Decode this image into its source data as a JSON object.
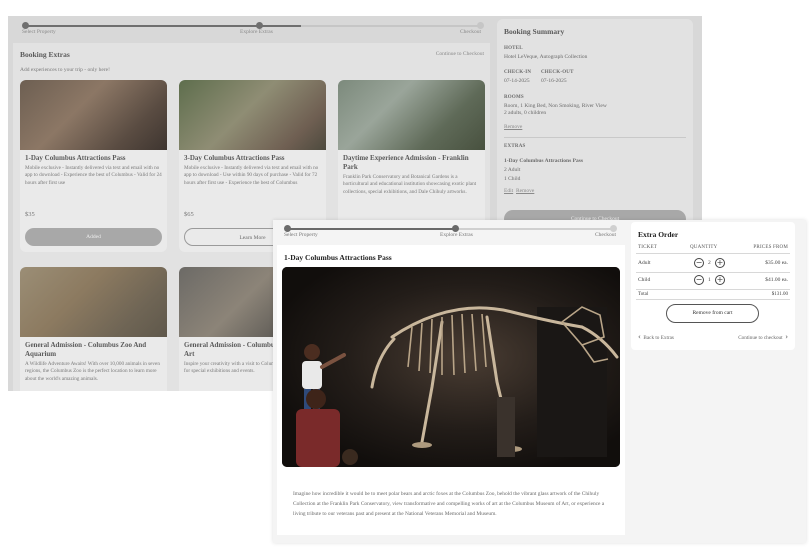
{
  "progress": {
    "steps": [
      "Select Property",
      "Explore Extras",
      "Checkout"
    ],
    "current_step": 2
  },
  "background": {
    "main_title": "Booking Extras",
    "continue_link": "Continue to Checkout",
    "subtitle": "Add experiences to your trip - only here!",
    "cards": [
      {
        "title": "1-Day Columbus Attractions Pass",
        "description": "Mobile exclusive - Instantly delivered via text and email with no app to download - Experience the best of Columbus - Valid for 24 hours after first use",
        "price": "$35",
        "button": "Added",
        "button_style": "filled"
      },
      {
        "title": "3-Day Columbus Attractions Pass",
        "description": "Mobile exclusive - Instantly delivered via text and email with no app to download - Use within 90 days of purchase - Valid for 72 hours after first use - Experience the best of Columbus",
        "price": "$65",
        "button": "Learn More",
        "button_style": "outline"
      },
      {
        "title": "Daytime Experience Admission - Franklin Park",
        "description": "Franklin Park Conservatory and Botanical Gardens is a horticultural and educational institution showcasing exotic plant collections, special exhibitions, and Dale Chihuly artworks."
      },
      {
        "title": "General Admission - Columbus Zoo And Aquarium",
        "description": "A Wildlife Adventure Awaits! With over 10,000 animals in seven regions, the Columbus Zoo is the perfect location to learn more about the world's amazing animals."
      },
      {
        "title": "General Admission - Columbus Museum of Art",
        "description": "Inspire your creativity with a visit to Columbus Museum of Art for special exhibitions and events."
      }
    ],
    "summary": {
      "title": "Booking Summary",
      "hotel_label": "HOTEL",
      "hotel_name": "Hotel LeVeque, Autograph Collection",
      "checkin_label": "CHECK-IN",
      "checkin": "07-14-2025",
      "checkout_label": "CHECK-OUT",
      "checkout": "07-16-2025",
      "rooms_label": "ROOMS",
      "room_desc": "Room, 1 King Bed, Non Smoking, River View",
      "room_guests": "2 adults, 0 children",
      "remove": "Remove",
      "extras_label": "EXTRAS",
      "extra_name": "1-Day Columbus Attractions Pass",
      "extra_adults": "2 Adult",
      "extra_child": "1 Child",
      "edit": "Edit",
      "remove2": "Remove",
      "checkout_button": "Continue to Checkout"
    }
  },
  "foreground": {
    "title": "1-Day Columbus Attractions Pass",
    "description": "Imagine how incredible it would be to meet polar bears and arctic foxes at the Columbus Zoo, behold the vibrant glass artwork of the Chihuly Collection at the Franklin Park Conservatory, view transformative and compelling works of art at the Columbus Museum of Art, or experience a living tribute to our veterans past and present at the National Veterans Memorial and Museum.",
    "order": {
      "title": "Extra Order",
      "headers": {
        "ticket": "TICKET",
        "quantity": "QUANTITY",
        "price": "PRICES FROM"
      },
      "rows": [
        {
          "name": "Adult",
          "qty": "2",
          "price": "$35.00 ea."
        },
        {
          "name": "Child",
          "qty": "1",
          "price": "$41.00 ea."
        }
      ],
      "total_label": "Total",
      "total_value": "$131.00",
      "remove_button": "Remove from cart",
      "back_link": "Back to Extras",
      "next_link": "Continue to checkout"
    }
  },
  "icons": {
    "minus": "minus-circle-icon",
    "plus": "plus-circle-icon",
    "back": "chevron-left-icon",
    "next": "chevron-right-icon"
  }
}
